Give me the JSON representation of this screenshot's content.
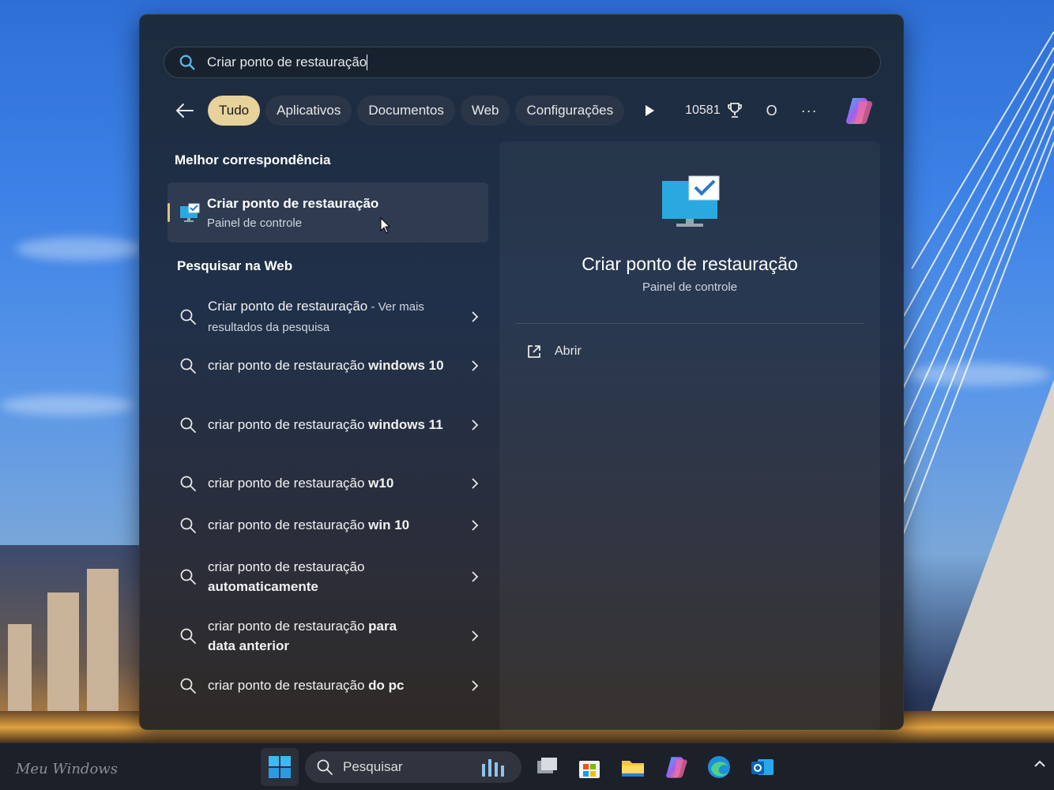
{
  "search": {
    "query": "Criar ponto de restauração"
  },
  "filters": {
    "tabs": [
      "Tudo",
      "Aplicativos",
      "Documentos",
      "Web",
      "Configurações"
    ],
    "active": "Tudo",
    "points": "10581",
    "avatar_letter": "O",
    "more": "···"
  },
  "best_match": {
    "section": "Melhor correspondência",
    "title": "Criar ponto de restauração",
    "subtitle": "Painel de controle"
  },
  "web": {
    "section": "Pesquisar na Web",
    "items": [
      {
        "prefix": "Criar ponto de restauração",
        "bold": "",
        "extra": " - Ver mais resultados da pesquisa"
      },
      {
        "prefix": "criar ponto de restauração ",
        "bold": "windows 10",
        "extra": ""
      },
      {
        "prefix": "criar ponto de restauração ",
        "bold": "windows 11",
        "extra": ""
      },
      {
        "prefix": "criar ponto de restauração ",
        "bold": "w10",
        "extra": ""
      },
      {
        "prefix": "criar ponto de restauração ",
        "bold": "win 10",
        "extra": ""
      },
      {
        "prefix": "criar ponto de restauração ",
        "bold": "automaticamente",
        "extra": ""
      },
      {
        "prefix": "criar ponto de restauração ",
        "bold": "para data anterior",
        "extra": ""
      },
      {
        "prefix": "criar ponto de restauração ",
        "bold": "do pc",
        "extra": ""
      }
    ]
  },
  "preview": {
    "title": "Criar ponto de restauração",
    "subtitle": "Painel de controle",
    "open_label": "Abrir"
  },
  "taskbar": {
    "brand": "Meu Windows",
    "search_placeholder": "Pesquisar"
  },
  "colors": {
    "active_chip": "#e6d29a",
    "accent_bar": "#e6c27a",
    "panel_bg": "#1d2b3d"
  }
}
